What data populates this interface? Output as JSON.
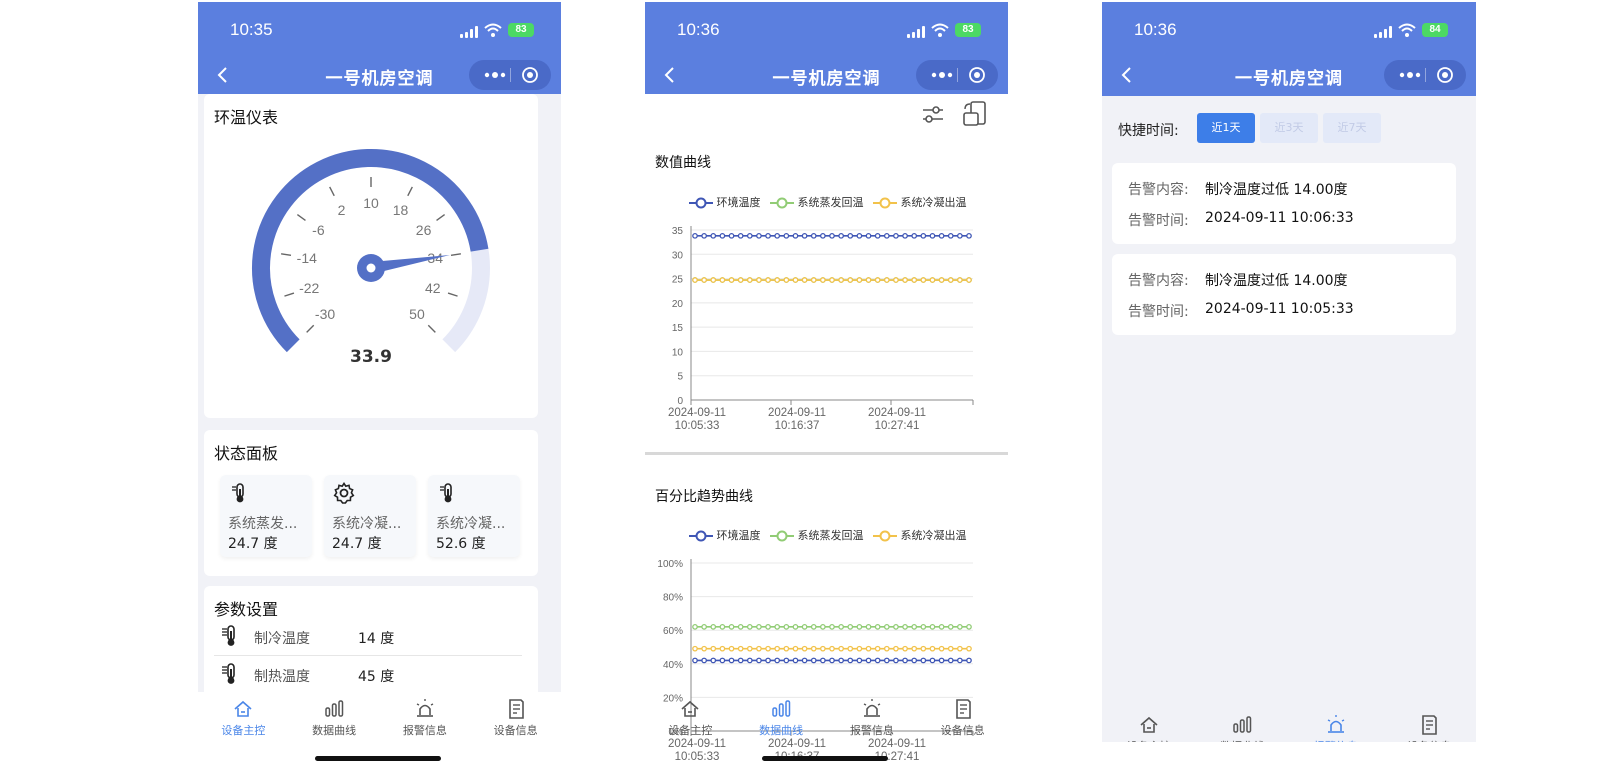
{
  "phones": [
    {
      "time": "10:35",
      "battery": "83",
      "title": "一号机房空调",
      "gauge": {
        "title": "环温仪表",
        "value": "33.9",
        "reading": 33.9,
        "min": -30,
        "max": 50,
        "ticks": [
          "-30",
          "-22",
          "-14",
          "-6",
          "2",
          "10",
          "18",
          "26",
          "34",
          "42",
          "50"
        ]
      },
      "status_panel": {
        "title": "状态面板",
        "items": [
          {
            "icon": "thermometer-icon",
            "label": "系统蒸发...",
            "value": "24.7 度"
          },
          {
            "icon": "gear-icon",
            "label": "系统冷凝...",
            "value": "24.7 度"
          },
          {
            "icon": "thermometer-icon",
            "label": "系统冷凝...",
            "value": "52.6 度"
          }
        ]
      },
      "params": {
        "title": "参数设置",
        "items": [
          {
            "icon": "thermometer-icon",
            "label": "制冷温度",
            "value": "14 度"
          },
          {
            "icon": "thermometer-icon",
            "label": "制热温度",
            "value": "45 度"
          }
        ]
      },
      "active_tab": 0
    },
    {
      "time": "10:36",
      "battery": "83",
      "title": "一号机房空调",
      "active_tab": 1
    },
    {
      "time": "10:36",
      "battery": "84",
      "title": "一号机房空调",
      "quick_time_label": "快捷时间:",
      "chips": [
        "近1天",
        "近3天",
        "近7天"
      ],
      "alarms": [
        {
          "k1": "告警内容:",
          "v1": "制冷温度过低 14.00度",
          "k2": "告警时间:",
          "v2": "2024-09-11 10:06:33"
        },
        {
          "k1": "告警内容:",
          "v1": "制冷温度过低 14.00度",
          "k2": "告警时间:",
          "v2": "2024-09-11 10:05:33"
        }
      ],
      "active_tab": 2
    }
  ],
  "tabs": [
    {
      "label": "设备主控",
      "icon": "home-icon"
    },
    {
      "label": "数据曲线",
      "icon": "bar-chart-icon"
    },
    {
      "label": "报警信息",
      "icon": "alarm-light-icon"
    },
    {
      "label": "设备信息",
      "icon": "document-icon"
    }
  ],
  "legend": [
    "环境温度",
    "系统蒸发回温",
    "系统冷凝出温"
  ],
  "colors": {
    "primary": "#5b7fdf",
    "series": [
      "#3f56b5",
      "#91cc75",
      "#f2c24a"
    ],
    "accent": "#4a86e8"
  },
  "chart_data": [
    {
      "type": "line",
      "title": "数值曲线",
      "x": [
        "2024-09-11\n10:05:33",
        "2024-09-11\n10:16:37",
        "2024-09-11\n10:27:41"
      ],
      "ylim": [
        0,
        35
      ],
      "yticks": [
        "0",
        "5",
        "10",
        "15",
        "20",
        "25",
        "30",
        "35"
      ],
      "points": 31,
      "series": [
        {
          "name": "环境温度",
          "values": [
            33.8
          ]
        },
        {
          "name": "系统蒸发回温",
          "values": [
            24.7
          ]
        },
        {
          "name": "系统冷凝出温",
          "values": [
            24.7
          ]
        }
      ]
    },
    {
      "type": "line",
      "title": "百分比趋势曲线",
      "x": [
        "2024-09-11\n10:05:33",
        "2024-09-11\n10:16:37",
        "2024-09-11\n10:27:41"
      ],
      "ylim": [
        0,
        100
      ],
      "yticks": [
        "0%",
        "20%",
        "40%",
        "60%",
        "80%",
        "100%"
      ],
      "points": 31,
      "series": [
        {
          "name": "环境温度",
          "values": [
            42
          ]
        },
        {
          "name": "系统蒸发回温",
          "values": [
            62
          ]
        },
        {
          "name": "系统冷凝出温",
          "values": [
            49
          ]
        }
      ]
    }
  ]
}
